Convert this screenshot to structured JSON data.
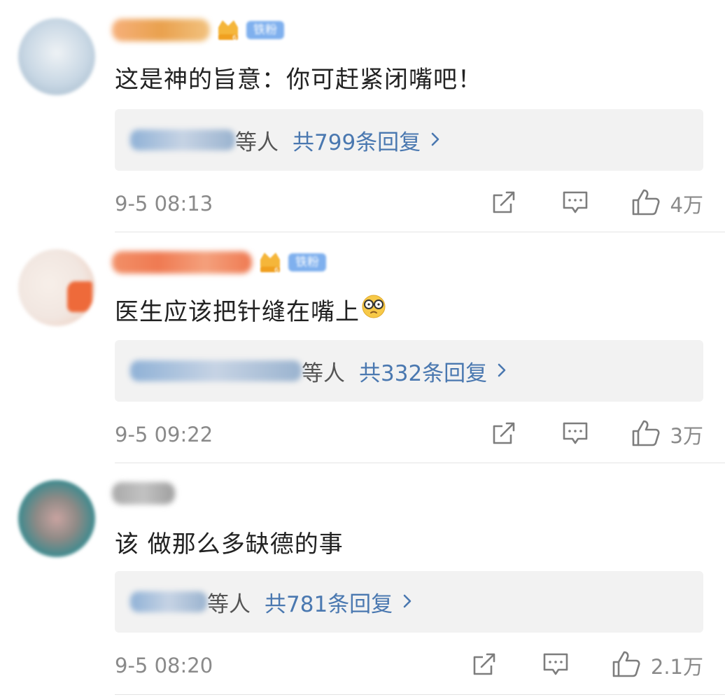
{
  "comments": [
    {
      "avatar": {
        "bg": "#c8d7e4",
        "accent": "#e8eef3"
      },
      "name_colors": [
        "#f6b07a",
        "#e9a14e"
      ],
      "name_width": 140,
      "fan_badge": "铁粉",
      "text": "这是神的旨意：你可赶紧闭嘴吧！",
      "emoji": "",
      "reply_names_width": 150,
      "reply_etc": "等人",
      "reply_count": "共799条回复",
      "time": "9-5 08:13",
      "likes": "4万"
    },
    {
      "avatar": {
        "bg": "#f1e6e0",
        "accent": "#ee6a3a"
      },
      "name_colors": [
        "#f29068",
        "#ef7a52"
      ],
      "name_width": 200,
      "fan_badge": "铁粉",
      "text": "医生应该把针缝在嘴上",
      "emoji": "glasses-emoji",
      "reply_names_width": 245,
      "reply_etc": "等人",
      "reply_count": "共332条回复",
      "time": "9-5 09:22",
      "likes": "3万"
    },
    {
      "avatar": {
        "bg": "#5a9a9c",
        "accent": "#2b6a70"
      },
      "name_colors": [
        "#a9a9a9",
        "#c2c2c2"
      ],
      "name_width": 90,
      "fan_badge": "",
      "text": "该 做那么多缺德的事",
      "emoji": "",
      "reply_names_width": 110,
      "reply_etc": "等人",
      "reply_count": "共781条回复",
      "time": "9-5 08:20",
      "likes": "2.1万"
    }
  ],
  "icons": {
    "repost": "repost-icon",
    "comment": "comment-icon",
    "like": "like-icon",
    "chevron": "chevron-right-icon"
  },
  "colors": {
    "link": "#4a78b0",
    "meta": "#8a8a8a",
    "reply_bg": "#f2f2f2",
    "text": "#222222"
  }
}
